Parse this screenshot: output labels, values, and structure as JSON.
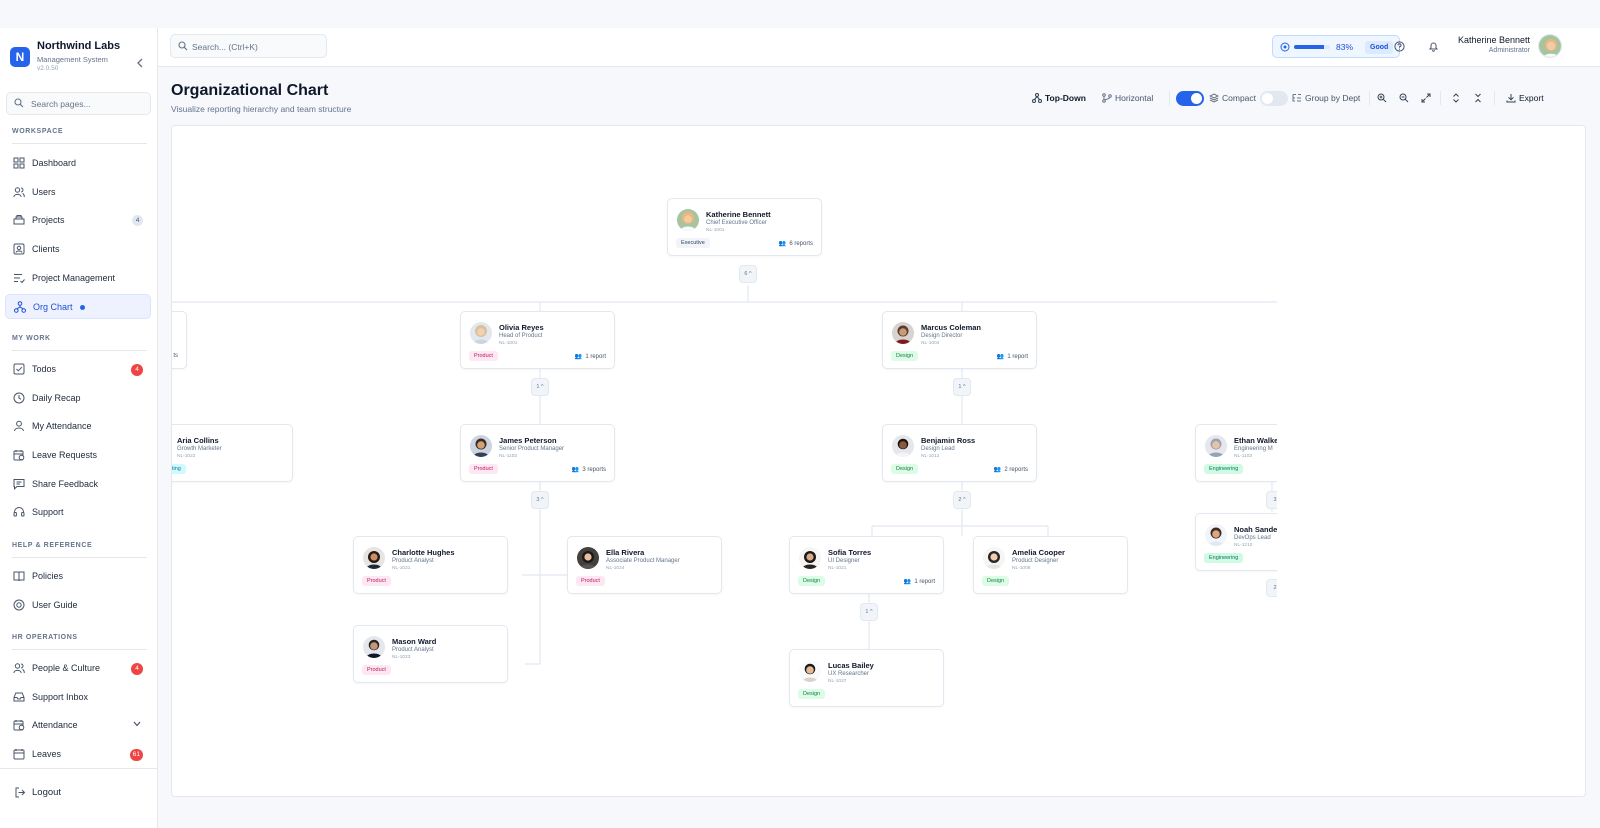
{
  "brand": {
    "name": "Northwind Labs",
    "subtitle": "Management System",
    "version": "v2.0.50",
    "logo_letter": "N"
  },
  "sidebar": {
    "search_placeholder": "Search pages...",
    "sections": {
      "workspace": "WORKSPACE",
      "mywork": "MY WORK",
      "help": "HELP & REFERENCE",
      "hr": "HR OPERATIONS"
    },
    "items": {
      "dashboard": "Dashboard",
      "users": "Users",
      "projects": "Projects",
      "projects_badge": "4",
      "clients": "Clients",
      "project_management": "Project Management",
      "org_chart": "Org Chart",
      "todos": "Todos",
      "todos_badge": "4",
      "daily_recap": "Daily Recap",
      "my_attendance": "My Attendance",
      "leave_requests": "Leave Requests",
      "share_feedback": "Share Feedback",
      "support": "Support",
      "policies": "Policies",
      "user_guide": "User Guide",
      "people_culture": "People & Culture",
      "people_badge": "4",
      "support_inbox": "Support Inbox",
      "attendance": "Attendance",
      "leaves": "Leaves",
      "leaves_badge": "61"
    },
    "logout": "Logout"
  },
  "header": {
    "search_placeholder": "Search... (Ctrl+K)",
    "performance": {
      "percent_label": "83%",
      "value": 0.83,
      "status": "Good"
    },
    "user": {
      "name": "Katherine Bennett",
      "role": "Administrator"
    }
  },
  "page": {
    "title": "Organizational Chart",
    "subtitle": "Visualize reporting hierarchy and team structure"
  },
  "toolbar": {
    "top_down": "Top-Down",
    "horizontal": "Horizontal",
    "compact": "Compact",
    "compact_on": true,
    "group_by_dept": "Group by Dept",
    "group_on": false,
    "export": "Export"
  },
  "colors": {
    "accent": "#2563eb",
    "danger": "#ef4444"
  },
  "org": {
    "ceo": {
      "name": "Katherine Bennett",
      "title": "Chief Executive Officer",
      "id": "NL-1001",
      "dept": "Executive",
      "reports": "6 reports",
      "expand": "6 ^"
    },
    "left_partial_rep": "ts",
    "olivia": {
      "name": "Olivia Reyes",
      "title": "Head of Product",
      "id": "NL-1001",
      "dept": "Product",
      "reports": "1 report",
      "expand": "1 ^"
    },
    "marcus": {
      "name": "Marcus Coleman",
      "title": "Design Director",
      "id": "NL-1004",
      "dept": "Design",
      "reports": "1 report",
      "expand": "1 ^"
    },
    "aria": {
      "name": "Aria Collins",
      "title": "Growth Marketer",
      "id": "NL-1022",
      "dept": "ting"
    },
    "james": {
      "name": "James Peterson",
      "title": "Senior Product Manager",
      "id": "NL-1102",
      "dept": "Product",
      "reports": "3 reports",
      "expand": "3 ^"
    },
    "benjamin": {
      "name": "Benjamin Ross",
      "title": "Design Lead",
      "id": "NL-1012",
      "dept": "Design",
      "reports": "2 reports",
      "expand": "2 ^"
    },
    "ethan": {
      "name": "Ethan Walke",
      "title": "Engineering M",
      "id": "NL-1103",
      "dept": "Engineering",
      "expand": "3"
    },
    "noah": {
      "name": "Noah Sande",
      "title": "DevOps Lead",
      "id": "NL-1210",
      "dept": "Engineering",
      "expand": "2"
    },
    "charlotte": {
      "name": "Charlotte Hughes",
      "title": "Product Analyst",
      "id": "NL-1021",
      "dept": "Product"
    },
    "ella": {
      "name": "Ella Rivera",
      "title": "Associate Product Manager",
      "id": "NL-1024",
      "dept": "Product"
    },
    "mason": {
      "name": "Mason Ward",
      "title": "Product Analyst",
      "id": "NL-1023",
      "dept": "Product"
    },
    "sofia": {
      "name": "Sofia Torres",
      "title": "UI Designer",
      "id": "NL-1021",
      "dept": "Design",
      "reports": "1 report",
      "expand": "1 ^"
    },
    "amelia": {
      "name": "Amelia Cooper",
      "title": "Product Designer",
      "id": "NL-1008",
      "dept": "Design"
    },
    "lucas": {
      "name": "Lucas Bailey",
      "title": "UX Researcher",
      "id": "NL-1037",
      "dept": "Design"
    }
  }
}
